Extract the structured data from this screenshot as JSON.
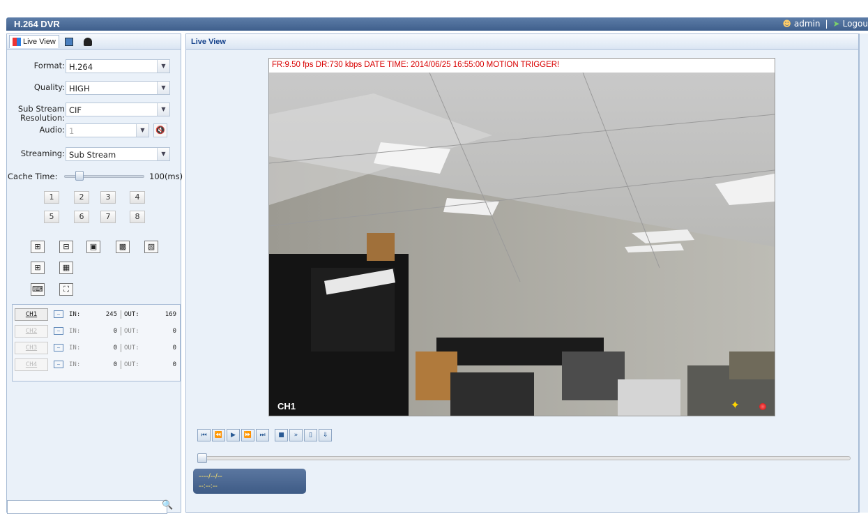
{
  "app": {
    "title": "H.264 DVR",
    "user": "admin",
    "separator": "|",
    "logout": "Logou"
  },
  "left_tabs": [
    {
      "label": "Live View"
    }
  ],
  "form": {
    "format": {
      "label": "Format:",
      "value": "H.264"
    },
    "quality": {
      "label": "Quality:",
      "value": "HIGH"
    },
    "substream": {
      "label1": "Sub Stream",
      "label2": "Resolution:",
      "value": "CIF"
    },
    "audio": {
      "label": "Audio:",
      "value": "1"
    },
    "streaming": {
      "label": "Streaming:",
      "value": "Sub Stream"
    },
    "cache": {
      "label": "Cache Time:",
      "value": "100(ms)",
      "level": 0.14
    }
  },
  "channel_buttons": [
    "1",
    "2",
    "3",
    "4",
    "5",
    "6",
    "7",
    "8"
  ],
  "channels": [
    {
      "name": "CH1",
      "in_label": "IN:",
      "in": "245",
      "out_label": "OUT:",
      "out": "169"
    },
    {
      "name": "CH2",
      "in_label": "IN:",
      "in": "0",
      "out_label": "OUT:",
      "out": "0"
    },
    {
      "name": "CH3",
      "in_label": "IN:",
      "in": "0",
      "out_label": "OUT:",
      "out": "0"
    },
    {
      "name": "CH4",
      "in_label": "IN:",
      "in": "0",
      "out_label": "OUT:",
      "out": "0"
    }
  ],
  "main": {
    "header": "Live View",
    "osd": "FR:9.50 fps  DR:730 kbps  DATE TIME: 2014/06/25 16:55:00  MOTION TRIGGER!",
    "channel_label": "CH1",
    "date": "----/--/--",
    "time": "--:--:--"
  },
  "colors": {
    "header_bar": "#4a6a96",
    "osd_text": "#d80000",
    "time_text": "#ffe46b"
  }
}
